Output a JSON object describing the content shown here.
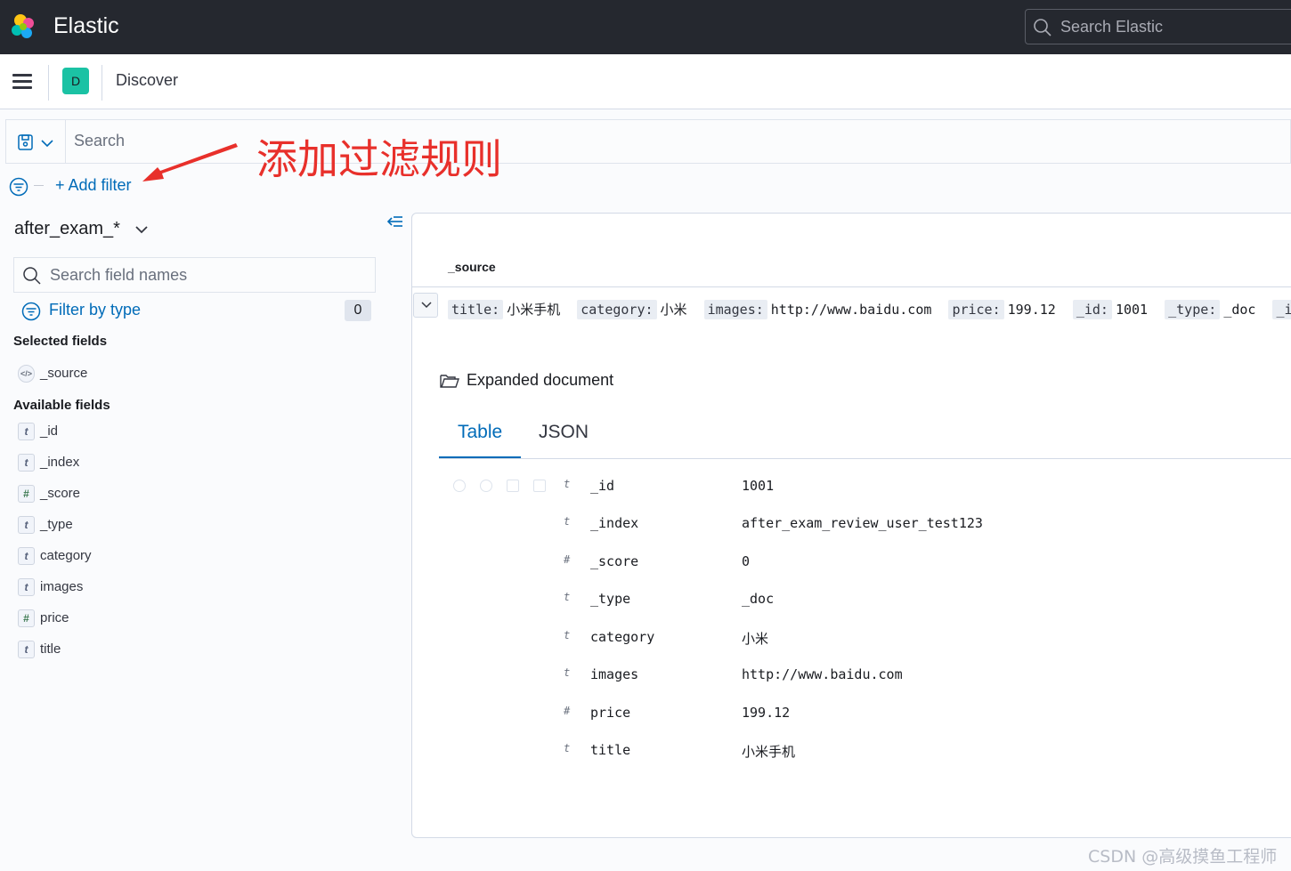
{
  "header": {
    "app_title": "Elastic",
    "search_placeholder": "Search Elastic"
  },
  "breadcrumb": {
    "space_initial": "D",
    "current": "Discover"
  },
  "query_bar": {
    "placeholder": "Search",
    "add_filter": "+ Add filter"
  },
  "annotation": {
    "text": "添加过滤规则",
    "color": "#e8302b"
  },
  "sidebar": {
    "index_pattern": "after_exam_*",
    "field_search_placeholder": "Search field names",
    "filter_by_type": "Filter by type",
    "filter_count": "0",
    "selected_title": "Selected fields",
    "selected_fields": [
      {
        "type": "source",
        "name": "_source"
      }
    ],
    "available_title": "Available fields",
    "available_fields": [
      {
        "type": "t",
        "name": "_id"
      },
      {
        "type": "t",
        "name": "_index"
      },
      {
        "type": "#",
        "name": "_score"
      },
      {
        "type": "t",
        "name": "_type"
      },
      {
        "type": "t",
        "name": "category"
      },
      {
        "type": "t",
        "name": "images"
      },
      {
        "type": "#",
        "name": "price"
      },
      {
        "type": "t",
        "name": "title"
      }
    ]
  },
  "document": {
    "column_header": "_source",
    "source_pairs": [
      {
        "key": "title:",
        "value": "小米手机"
      },
      {
        "key": "category:",
        "value": "小米"
      },
      {
        "key": "images:",
        "value": "http://www.baidu.com"
      },
      {
        "key": "price:",
        "value": "199.12"
      },
      {
        "key": "_id:",
        "value": "1001"
      },
      {
        "key": "_type:",
        "value": "_doc"
      },
      {
        "key": "_index:",
        "value": ""
      }
    ],
    "expanded_title": "Expanded document",
    "tabs": {
      "table": "Table",
      "json": "JSON"
    },
    "rows": [
      {
        "type": "t",
        "field": "_id",
        "value": "1001"
      },
      {
        "type": "t",
        "field": "_index",
        "value": "after_exam_review_user_test123"
      },
      {
        "type": "#",
        "field": "_score",
        "value": "0"
      },
      {
        "type": "t",
        "field": "_type",
        "value": "_doc"
      },
      {
        "type": "t",
        "field": "category",
        "value": "小米"
      },
      {
        "type": "t",
        "field": "images",
        "value": "http://www.baidu.com"
      },
      {
        "type": "#",
        "field": "price",
        "value": "199.12"
      },
      {
        "type": "t",
        "field": "title",
        "value": "小米手机"
      }
    ]
  },
  "watermark": "CSDN @高级摸鱼工程师"
}
